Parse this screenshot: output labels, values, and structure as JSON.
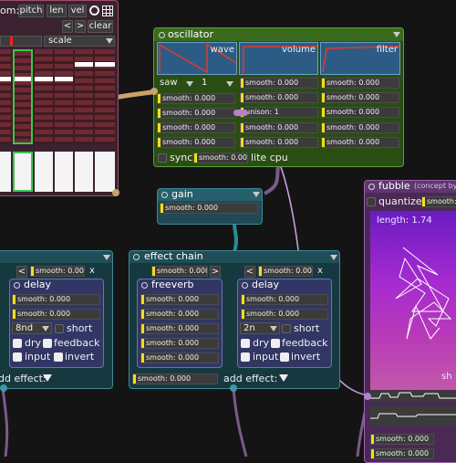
{
  "sequencer": {
    "from_label": "om:",
    "tabs": [
      "pitch",
      "len",
      "vel"
    ],
    "prev_label": "<",
    "next_label": ">",
    "clear_label": "clear",
    "scale_label": "scale"
  },
  "oscillator": {
    "title": "oscillator",
    "graphs": [
      "wave",
      "volume",
      "filter"
    ],
    "wave_select": "saw",
    "voices_value": "1",
    "smooth_label": "smooth: 0.000",
    "unison_label": "unison: 1",
    "sync_label": "sync",
    "lite_cpu_label": "lite cpu"
  },
  "gain": {
    "title": "gain",
    "smooth_label": "smooth: 0.000"
  },
  "effect_chain": {
    "title": "effect chain",
    "smooth_label": "smooth: 0.000",
    "add_effect_label": "add effect:"
  },
  "left_chain": {
    "smooth_label": "smooth: 0.000",
    "add_effect_label": "dd effect:",
    "remove_label": "x",
    "prev_label": "<"
  },
  "delay_left": {
    "title": "delay",
    "smooth_label": "smooth: 0.000",
    "division": "8nd",
    "short_label": "short",
    "dry_label": "dry",
    "feedback_label": "feedback",
    "input_label": "input",
    "invert_label": "invert"
  },
  "freeverb": {
    "title": "freeverb",
    "smooth_label": "smooth: 0.000"
  },
  "delay_right": {
    "title": "delay",
    "smooth_label": "smooth: 0.000",
    "prev_label": "<",
    "remove_label": "x",
    "division": "2n",
    "short_label": "short",
    "dry_label": "dry",
    "feedback_label": "feedback",
    "input_label": "input",
    "invert_label": "invert"
  },
  "fubble": {
    "title": "fubble",
    "subtitle": "(concept by",
    "quantize_label": "quantize",
    "smooth_label": "smooth:",
    "length_label": "length: 1.74",
    "shape_label": "sh",
    "bottom_smooth_label": "smooth: 0.000"
  },
  "colors": {
    "background": "#141414",
    "oscillator": "#2a4d14",
    "gain": "#1e4a55",
    "effect_chain": "#16393f",
    "delay": "#313664",
    "fubble": "#4a2a55",
    "slider_handle": "#f2df1c",
    "cable": "#c49bd8"
  }
}
